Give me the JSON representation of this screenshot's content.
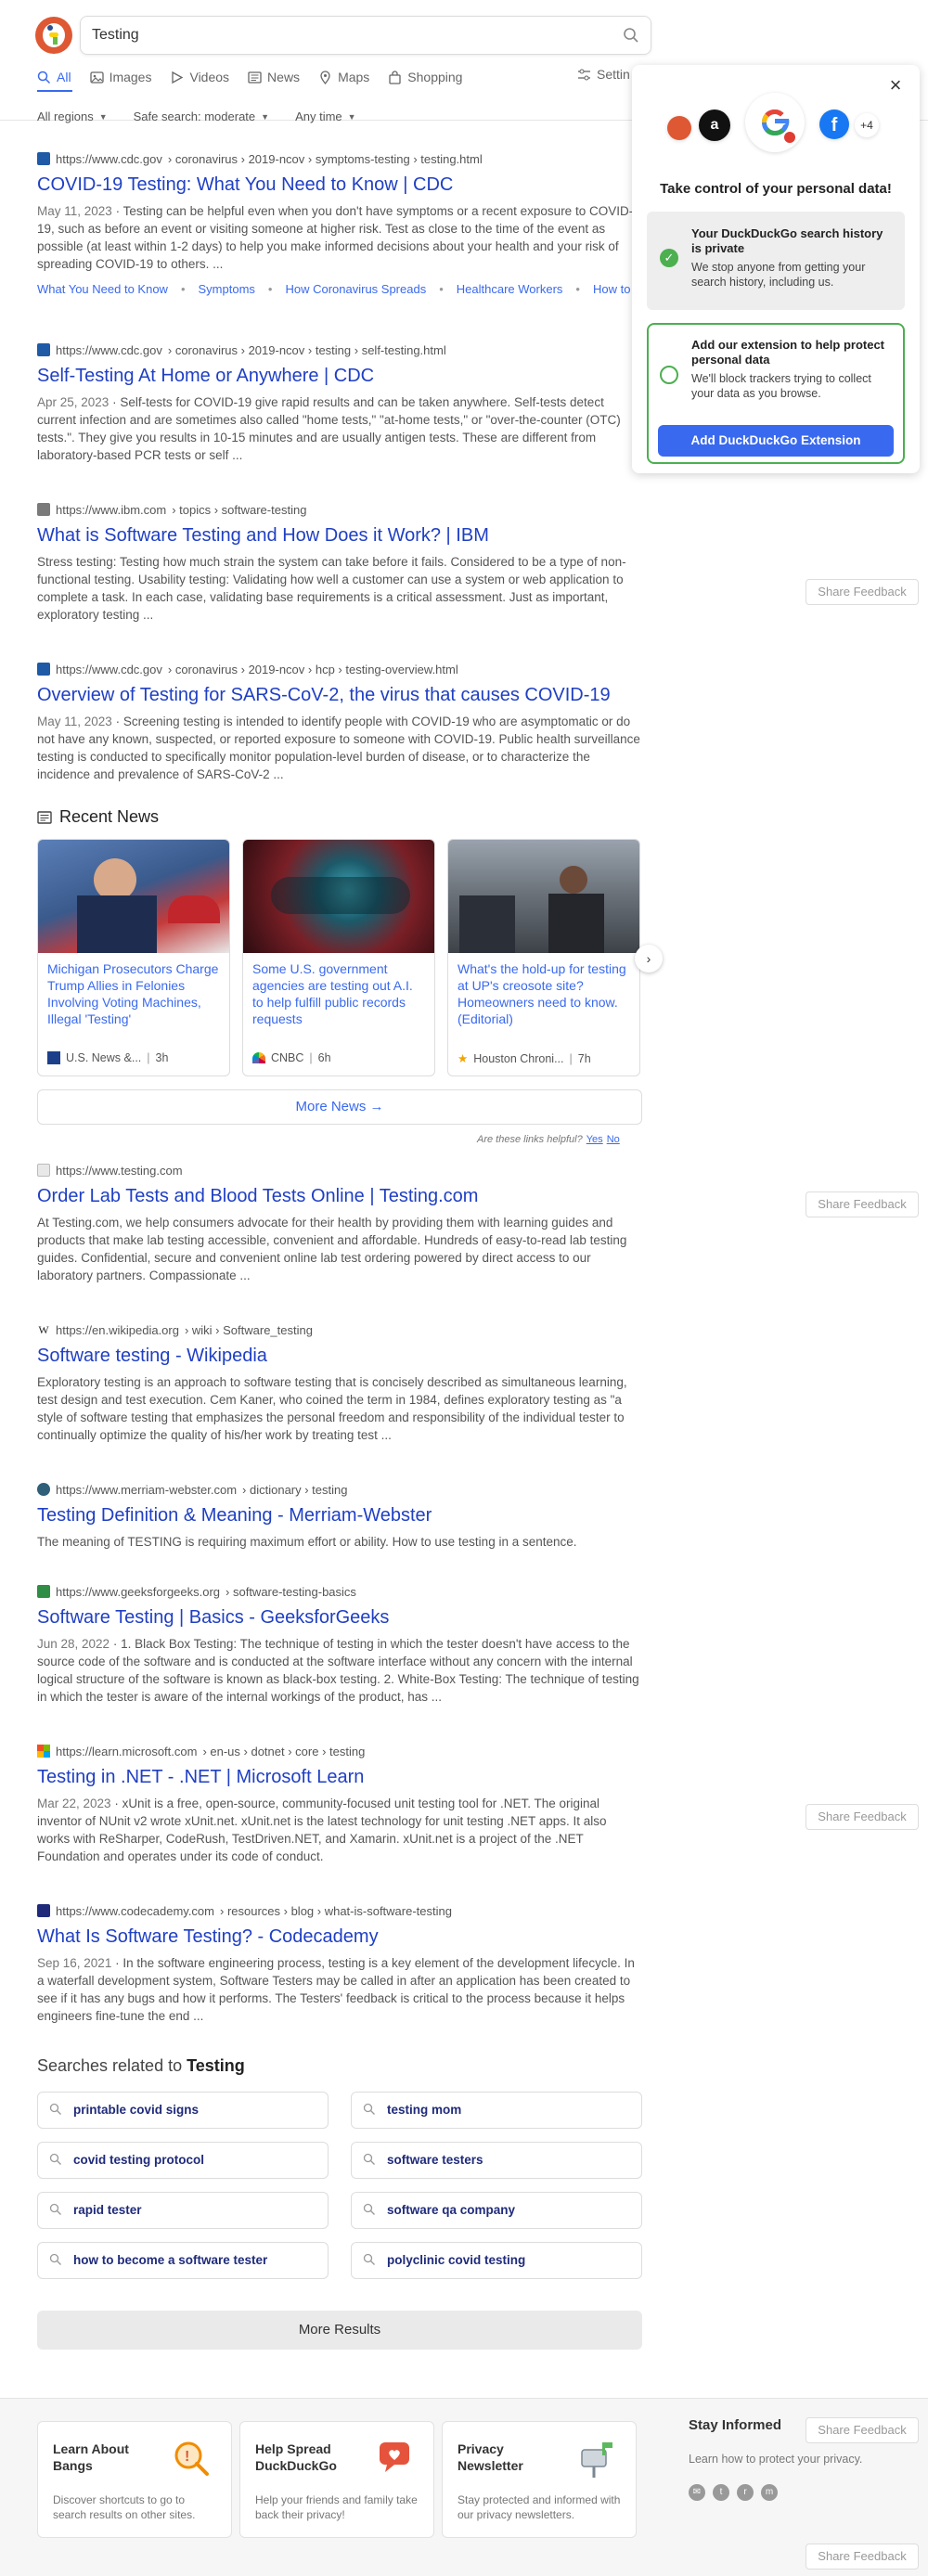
{
  "search": {
    "query": "Testing"
  },
  "tabs": [
    {
      "label": "All",
      "icon": "search-icon"
    },
    {
      "label": "Images",
      "icon": "image-icon"
    },
    {
      "label": "Videos",
      "icon": "play-icon"
    },
    {
      "label": "News",
      "icon": "newspaper-icon"
    },
    {
      "label": "Maps",
      "icon": "map-pin-icon"
    },
    {
      "label": "Shopping",
      "icon": "shopping-bag-icon"
    }
  ],
  "settings_label": "Settin",
  "filters": {
    "region": "All regions",
    "safe_search": "Safe search: moderate",
    "time": "Any time"
  },
  "colors": {
    "brand": "#de5833",
    "link": "#1f3fc4",
    "accent": "#3969ef",
    "green": "#4caf50"
  },
  "results": [
    {
      "url_domain": "https://www.cdc.gov",
      "url_path": "› coronavirus › 2019-ncov › symptoms-testing › testing.html",
      "title": "COVID-19 Testing: What You Need to Know | CDC",
      "date": "May 11, 2023",
      "snippet": "Testing can be helpful even when you don't have symptoms or a recent exposure to COVID-19, such as before an event or visiting someone at higher risk. Test as close to the time of the event as possible (at least within 1-2 days) to help you make informed decisions about your health and your risk of spreading COVID-19 to others. ...",
      "sitelinks": [
        "What You Need to Know",
        "Symptoms",
        "How Coronavirus Spreads",
        "Healthcare Workers",
        "How to P"
      ]
    },
    {
      "url_domain": "https://www.cdc.gov",
      "url_path": "› coronavirus › 2019-ncov › testing › self-testing.html",
      "title": "Self-Testing At Home or Anywhere | CDC",
      "date": "Apr 25, 2023",
      "snippet": "Self-tests for COVID-19 give rapid results and can be taken anywhere. Self-tests detect current infection and are sometimes also called \"home tests,\" \"at-home tests,\" or \"over-the-counter (OTC) tests.\". They give you results in 10-15 minutes and are usually antigen tests. These are different from laboratory-based PCR tests or self ..."
    },
    {
      "url_domain": "https://www.ibm.com",
      "url_path": "› topics › software-testing",
      "title": "What is Software Testing and How Does it Work? | IBM",
      "date": "",
      "snippet": "Stress testing: Testing how much strain the system can take before it fails. Considered to be a type of non-functional testing. Usability testing: Validating how well a customer can use a system or web application to complete a task. In each case, validating base requirements is a critical assessment. Just as important, exploratory testing ..."
    },
    {
      "url_domain": "https://www.cdc.gov",
      "url_path": "› coronavirus › 2019-ncov › hcp › testing-overview.html",
      "title": "Overview of Testing for SARS-CoV-2, the virus that causes COVID-19",
      "date": "May 11, 2023",
      "snippet": "Screening testing is intended to identify people with COVID-19 who are asymptomatic or do not have any known, suspected, or reported exposure to someone with COVID-19. Public health surveillance testing is conducted to specifically monitor population-level burden of disease, or to characterize the incidence and prevalence of SARS-CoV-2 ..."
    },
    {
      "url_domain": "https://www.testing.com",
      "url_path": "",
      "title": "Order Lab Tests and Blood Tests Online | Testing.com",
      "date": "",
      "snippet": "At Testing.com, we help consumers advocate for their health by providing them with learning guides and products that make lab testing accessible, convenient and affordable. Hundreds of easy-to-read lab testing guides. Confidential, secure and convenient online lab test ordering powered by direct access to our laboratory partners. Compassionate ..."
    },
    {
      "url_domain": "https://en.wikipedia.org",
      "url_path": "› wiki › Software_testing",
      "title": "Software testing - Wikipedia",
      "date": "",
      "snippet": "Exploratory testing is an approach to software testing that is concisely described as simultaneous learning, test design and test execution. Cem Kaner, who coined the term in 1984, defines exploratory testing as \"a style of software testing that emphasizes the personal freedom and responsibility of the individual tester to continually optimize the quality of his/her work by treating test ..."
    },
    {
      "url_domain": "https://www.merriam-webster.com",
      "url_path": "› dictionary › testing",
      "title": "Testing Definition & Meaning - Merriam-Webster",
      "date": "",
      "snippet": "The meaning of TESTING is requiring maximum effort or ability. How to use testing in a sentence."
    },
    {
      "url_domain": "https://www.geeksforgeeks.org",
      "url_path": "› software-testing-basics",
      "title": "Software Testing | Basics - GeeksforGeeks",
      "date": "Jun 28, 2022",
      "snippet": "1. Black Box Testing: The technique of testing in which the tester doesn't have access to the source code of the software and is conducted at the software interface without any concern with the internal logical structure of the software is known as black-box testing. 2. White-Box Testing: The technique of testing in which the tester is aware of the internal workings of the product, has ..."
    },
    {
      "url_domain": "https://learn.microsoft.com",
      "url_path": "› en-us › dotnet › core › testing",
      "title": "Testing in .NET - .NET | Microsoft Learn",
      "date": "Mar 22, 2023",
      "snippet": "xUnit is a free, open-source, community-focused unit testing tool for .NET. The original inventor of NUnit v2 wrote xUnit.net. xUnit.net is the latest technology for unit testing .NET apps. It also works with ReSharper, CodeRush, TestDriven.NET, and Xamarin. xUnit.net is a project of the .NET Foundation and operates under its code of conduct."
    },
    {
      "url_domain": "https://www.codecademy.com",
      "url_path": "› resources › blog › what-is-software-testing",
      "title": "What Is Software Testing? - Codecademy",
      "date": "Sep 16, 2021",
      "snippet": "In the software engineering process, testing is a key element of the development lifecycle. In a waterfall development system, Software Testers may be called in after an application has been created to see if it has any bugs and how it performs. The Testers' feedback is critical to the process because it helps engineers fine-tune the end ..."
    }
  ],
  "share_feedback": "Share Feedback",
  "extension_popup": {
    "title": "Take control of your personal data!",
    "plus_count": "+4",
    "private_head": "Your DuckDuckGo search history is private",
    "private_body": "We stop anyone from getting your search history, including us.",
    "add_head": "Add our extension to help protect personal data",
    "add_body": "We'll block trackers trying to collect your data as you browse.",
    "add_button": "Add DuckDuckGo Extension"
  },
  "news": {
    "header": "Recent News",
    "items": [
      {
        "title": "Michigan Prosecutors Charge Trump Allies in Felonies Involving Voting Machines, Illegal 'Testing'",
        "source": "U.S. News &...",
        "age": "3h"
      },
      {
        "title": "Some U.S. government agencies are testing out A.I. to help fulfill public records requests",
        "source": "CNBC",
        "age": "6h"
      },
      {
        "title": "What's the hold-up for testing at UP's creosote site? Homeowners need to know. (Editorial)",
        "source": "Houston Chroni...",
        "age": "7h"
      }
    ],
    "more": "More News",
    "helpful_q": "Are these links helpful?",
    "yes": "Yes",
    "no": "No"
  },
  "related": {
    "prefix": "Searches related to",
    "term": "Testing",
    "items": [
      "printable covid signs",
      "testing mom",
      "covid testing protocol",
      "software testers",
      "rapid tester",
      "software qa company",
      "how to become a software tester",
      "polyclinic covid testing"
    ]
  },
  "more_results": "More Results",
  "footer": {
    "cards": [
      {
        "title": "Learn About Bangs",
        "body": "Discover shortcuts to go to search results on other sites."
      },
      {
        "title": "Help Spread DuckDuckGo",
        "body": "Help your friends and family take back their privacy!"
      },
      {
        "title": "Privacy Newsletter",
        "body": "Stay protected and informed with our privacy newsletters."
      }
    ],
    "stay_informed": "Stay Informed",
    "stay_text": "Learn how to protect your privacy."
  }
}
